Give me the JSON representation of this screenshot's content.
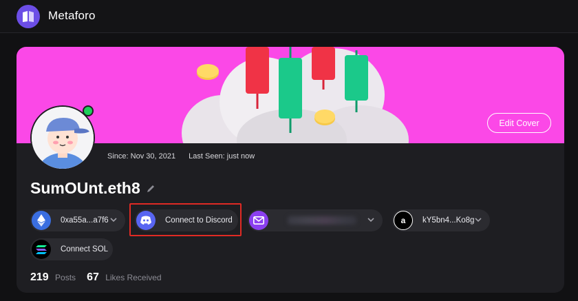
{
  "app": {
    "title": "Metaforo"
  },
  "colors": {
    "cover": "#fb48e7",
    "accent": "#6c4ee6",
    "online": "#1fcf5b",
    "highlight": "#e02a24"
  },
  "profile": {
    "cover_button": "Edit Cover",
    "since": "Since: Nov 30, 2021",
    "last_seen": "Last Seen: just now",
    "username": "SumOUnt.eth8"
  },
  "connections": {
    "eth_address": "0xa55a...a7f6",
    "discord_label": "Connect to Discord",
    "email_value": "",
    "arweave_address": "kY5bn4...Ko8g",
    "sol_label": "Connect SOL"
  },
  "icons": {
    "logo": "metaforo-logo-icon",
    "eth": "ethereum-icon",
    "discord": "discord-icon",
    "email": "mail-icon",
    "arweave": "arweave-icon",
    "sol": "solana-icon",
    "edit": "pencil-icon",
    "chevron": "chevron-down-icon"
  },
  "stats": {
    "posts_count": "219",
    "posts_label": "Posts",
    "likes_count": "67",
    "likes_label": "Likes Received"
  }
}
